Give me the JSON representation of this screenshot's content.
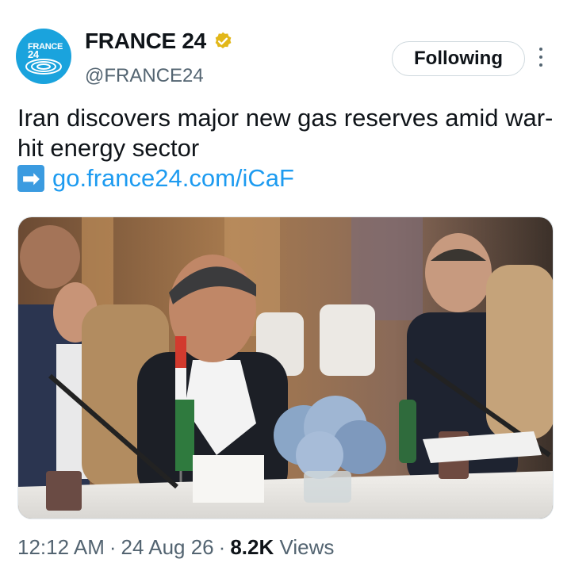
{
  "author": {
    "avatar_text_line1": "FRANCE",
    "avatar_text_line2": "24",
    "display_name": "FRANCE 24",
    "handle": "@FRANCE24",
    "verified_icon": "gold-verified-badge-icon"
  },
  "follow_button": {
    "label": "Following"
  },
  "more_menu": {
    "icon": "more-vertical-icon"
  },
  "tweet": {
    "text": "Iran discovers major new gas reserves amid war-hit energy sector",
    "link_emoji": "➡️",
    "link_text": "go.france24.com/iCaF"
  },
  "media": {
    "description_type": "photo"
  },
  "meta": {
    "time": "12:12 AM",
    "separator": "·",
    "date": "24 Aug 26",
    "views_count": "8.2K",
    "views_label": "Views"
  },
  "colors": {
    "link": "#1d9bf0",
    "secondary_text": "#536471",
    "avatar_bg": "#1aa3dd",
    "verified_gold": "#e2b719"
  }
}
